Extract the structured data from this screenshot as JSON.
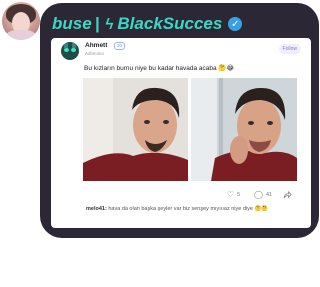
{
  "header": {
    "brand": "buse",
    "separator": "|",
    "bolt": "ϟ",
    "channel": "BlackSucces",
    "verified_mark": "✓"
  },
  "post": {
    "username": "Ahmett",
    "level": "20",
    "subtitle": "Adlımının",
    "follow_label": "Follow",
    "caption": "Bu kızların burnu niye bu kadar havada acaba 🤔😂",
    "likes": "5",
    "comments_count": "41",
    "top_comment": {
      "user": "melo41:",
      "text": "hava da olan başka şeyler var biz senşey mıyıııaz niye diye 🤔🤔"
    }
  },
  "icons": {
    "like": "heart-icon",
    "comment": "comment-icon",
    "share": "share-icon"
  },
  "colors": {
    "card_bg": "#2b2735",
    "accent": "#3ad8c6",
    "verified": "#3aa0e6"
  }
}
